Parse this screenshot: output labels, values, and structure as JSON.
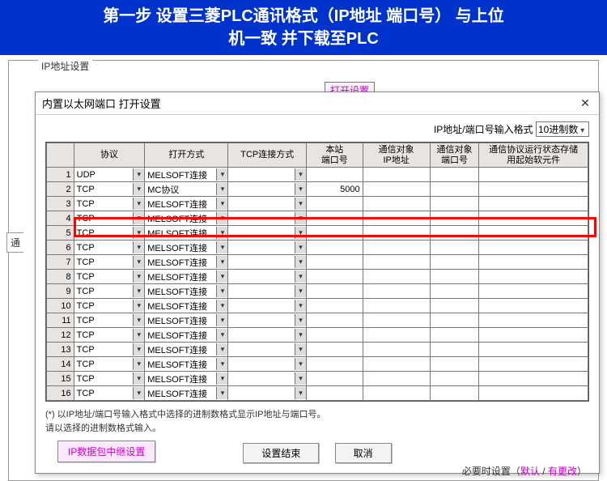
{
  "banner": {
    "line1": "第一步 设置三菱PLC通讯格式（IP地址 端口号）  与上位",
    "line2": "机一致 并下载至PLC"
  },
  "group_label": "IP地址设置",
  "behind_button": "打开设置",
  "side_tab": "通",
  "dialog": {
    "title": "内置以太网端口 打开设置",
    "format_label": "IP地址/端口号输入格式",
    "format_value": "10进制数"
  },
  "columns": {
    "idx": "",
    "protocol": "协议",
    "open_method": "打开方式",
    "tcp_method": "TCP连接方式",
    "local_port": "本站\n端口号",
    "remote_ip": "通信对象\nIP地址",
    "remote_port": "通信对象\n端口号",
    "device": "通信协议运行状态存储\n用起始软元件"
  },
  "rows": [
    {
      "idx": "1",
      "protocol": "UDP",
      "open_method": "MELSOFT连接",
      "tcp_method": "",
      "local_port": "",
      "remote_ip": "",
      "remote_port": "",
      "device": ""
    },
    {
      "idx": "2",
      "protocol": "TCP",
      "open_method": "MC协议",
      "tcp_method": "",
      "local_port": "5000",
      "remote_ip": "",
      "remote_port": "",
      "device": ""
    },
    {
      "idx": "3",
      "protocol": "TCP",
      "open_method": "MELSOFT连接",
      "tcp_method": "",
      "local_port": "",
      "remote_ip": "",
      "remote_port": "",
      "device": ""
    },
    {
      "idx": "4",
      "protocol": "TCP",
      "open_method": "MELSOFT连接",
      "tcp_method": "",
      "local_port": "",
      "remote_ip": "",
      "remote_port": "",
      "device": ""
    },
    {
      "idx": "5",
      "protocol": "TCP",
      "open_method": "MELSOFT连接",
      "tcp_method": "",
      "local_port": "",
      "remote_ip": "",
      "remote_port": "",
      "device": ""
    },
    {
      "idx": "6",
      "protocol": "TCP",
      "open_method": "MELSOFT连接",
      "tcp_method": "",
      "local_port": "",
      "remote_ip": "",
      "remote_port": "",
      "device": ""
    },
    {
      "idx": "7",
      "protocol": "TCP",
      "open_method": "MELSOFT连接",
      "tcp_method": "",
      "local_port": "",
      "remote_ip": "",
      "remote_port": "",
      "device": ""
    },
    {
      "idx": "8",
      "protocol": "TCP",
      "open_method": "MELSOFT连接",
      "tcp_method": "",
      "local_port": "",
      "remote_ip": "",
      "remote_port": "",
      "device": ""
    },
    {
      "idx": "9",
      "protocol": "TCP",
      "open_method": "MELSOFT连接",
      "tcp_method": "",
      "local_port": "",
      "remote_ip": "",
      "remote_port": "",
      "device": ""
    },
    {
      "idx": "10",
      "protocol": "TCP",
      "open_method": "MELSOFT连接",
      "tcp_method": "",
      "local_port": "",
      "remote_ip": "",
      "remote_port": "",
      "device": ""
    },
    {
      "idx": "11",
      "protocol": "TCP",
      "open_method": "MELSOFT连接",
      "tcp_method": "",
      "local_port": "",
      "remote_ip": "",
      "remote_port": "",
      "device": ""
    },
    {
      "idx": "12",
      "protocol": "TCP",
      "open_method": "MELSOFT连接",
      "tcp_method": "",
      "local_port": "",
      "remote_ip": "",
      "remote_port": "",
      "device": ""
    },
    {
      "idx": "13",
      "protocol": "TCP",
      "open_method": "MELSOFT连接",
      "tcp_method": "",
      "local_port": "",
      "remote_ip": "",
      "remote_port": "",
      "device": ""
    },
    {
      "idx": "14",
      "protocol": "TCP",
      "open_method": "MELSOFT连接",
      "tcp_method": "",
      "local_port": "",
      "remote_ip": "",
      "remote_port": "",
      "device": ""
    },
    {
      "idx": "15",
      "protocol": "TCP",
      "open_method": "MELSOFT连接",
      "tcp_method": "",
      "local_port": "",
      "remote_ip": "",
      "remote_port": "",
      "device": ""
    },
    {
      "idx": "16",
      "protocol": "TCP",
      "open_method": "MELSOFT连接",
      "tcp_method": "",
      "local_port": "",
      "remote_ip": "",
      "remote_port": "",
      "device": ""
    }
  ],
  "note_line1": "(*) 以IP地址/端口号输入格式中选择的进制数格式显示IP地址与端口号。",
  "note_line2": "请以选择的进制数格式输入。",
  "buttons": {
    "ok": "设置结束",
    "cancel": "取消"
  },
  "relay_button": "IP数据包中继设置",
  "footer": {
    "prefix": "必要时设置（",
    "default": "默认",
    "sep": " / ",
    "changed": "有更改",
    "suffix": "）"
  }
}
